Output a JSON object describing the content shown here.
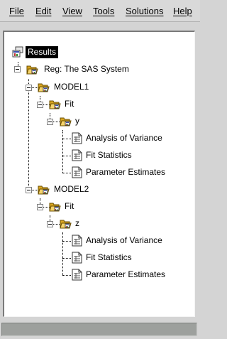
{
  "menubar": {
    "items": [
      "File",
      "Edit",
      "View",
      "Tools",
      "Solutions",
      "Help"
    ]
  },
  "tree": {
    "root": "Results",
    "reg": "Reg:  The SAS System",
    "model1": {
      "label": "MODEL1",
      "fit": "Fit",
      "var": "y",
      "tables": [
        "Analysis of Variance",
        "Fit Statistics",
        "Parameter Estimates"
      ]
    },
    "model2": {
      "label": "MODEL2",
      "fit": "Fit",
      "var": "z",
      "tables": [
        "Analysis of Variance",
        "Fit Statistics",
        "Parameter Estimates"
      ]
    }
  },
  "statusbar": {
    "text": ""
  }
}
